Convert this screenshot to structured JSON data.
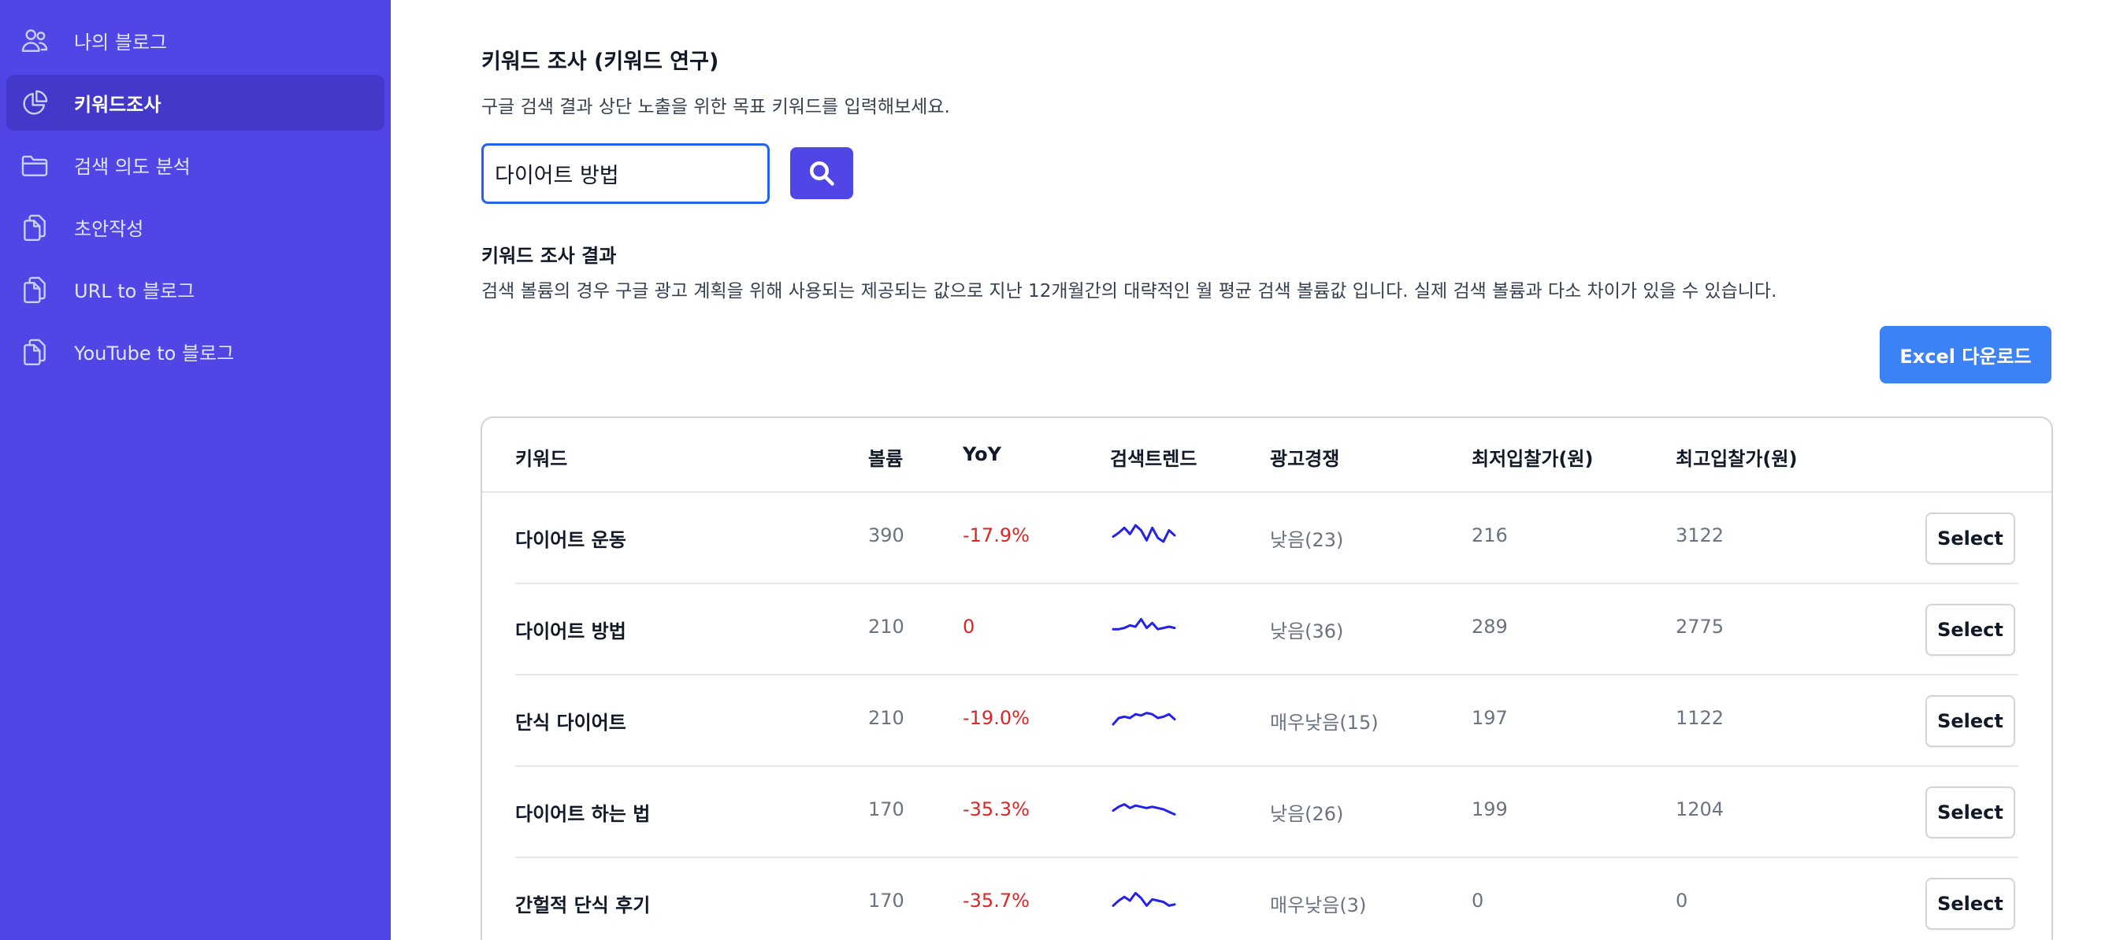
{
  "sidebar": {
    "items": [
      {
        "label": "나의 블로그",
        "icon": "users-icon"
      },
      {
        "label": "키워드조사",
        "icon": "pie-chart-icon"
      },
      {
        "label": "검색 의도 분석",
        "icon": "folder-icon"
      },
      {
        "label": "초안작성",
        "icon": "documents-icon"
      },
      {
        "label": "URL to 블로그",
        "icon": "documents-icon"
      },
      {
        "label": "YouTube to 블로그",
        "icon": "documents-icon"
      }
    ],
    "active_index": 1
  },
  "main": {
    "title": "키워드 조사 (키워드 연구)",
    "description": "구글 검색 결과 상단 노출을 위한 목표 키워드를 입력해보세요.",
    "search": {
      "value": "다이어트 방법",
      "placeholder": ""
    },
    "results_title": "키워드 조사 결과",
    "results_description": "검색 볼륨의 경우 구글 광고 계획을 위해 사용되는 제공되는 값으로 지난 12개월간의 대략적인 월 평균 검색 볼륨값 입니다. 실제 검색 볼륨과 다소 차이가 있을 수 있습니다.",
    "excel_button": "Excel 다운로드"
  },
  "table": {
    "headers": {
      "keyword": "키워드",
      "volume": "볼륨",
      "yoy": "YoY",
      "trend": "검색트렌드",
      "competition": "광고경쟁",
      "min_bid": "최저입찰가(원)",
      "max_bid": "최고입찰가(원)"
    },
    "rows": [
      {
        "keyword": "다이어트 운동",
        "volume": "390",
        "yoy": "-17.9%",
        "competition": "낮음(23)",
        "min_bid": "216",
        "max_bid": "3122",
        "select": "Select",
        "trend": [
          0.55,
          0.4,
          0.2,
          0.45,
          0.1,
          0.3,
          0.7,
          0.2,
          0.6,
          0.75,
          0.3,
          0.5
        ]
      },
      {
        "keyword": "다이어트 방법",
        "volume": "210",
        "yoy": "0",
        "competition": "낮음(36)",
        "min_bid": "289",
        "max_bid": "2775",
        "select": "Select",
        "trend": [
          0.6,
          0.6,
          0.55,
          0.45,
          0.5,
          0.2,
          0.55,
          0.35,
          0.6,
          0.55,
          0.5,
          0.55
        ]
      },
      {
        "keyword": "단식 다이어트",
        "volume": "210",
        "yoy": "-19.0%",
        "competition": "매우낮음(15)",
        "min_bid": "197",
        "max_bid": "1122",
        "select": "Select",
        "trend": [
          0.75,
          0.5,
          0.45,
          0.5,
          0.35,
          0.4,
          0.3,
          0.35,
          0.5,
          0.45,
          0.35,
          0.55
        ]
      },
      {
        "keyword": "다이어트 하는 법",
        "volume": "170",
        "yoy": "-35.3%",
        "competition": "낮음(26)",
        "min_bid": "199",
        "max_bid": "1204",
        "select": "Select",
        "trend": [
          0.55,
          0.4,
          0.3,
          0.45,
          0.35,
          0.4,
          0.45,
          0.4,
          0.45,
          0.5,
          0.6,
          0.7
        ]
      },
      {
        "keyword": "간헐적 단식 후기",
        "volume": "170",
        "yoy": "-35.7%",
        "competition": "매우낮음(3)",
        "min_bid": "0",
        "max_bid": "0",
        "select": "Select",
        "trend": [
          0.7,
          0.5,
          0.35,
          0.5,
          0.2,
          0.4,
          0.7,
          0.45,
          0.5,
          0.55,
          0.7,
          0.65
        ]
      }
    ]
  },
  "colors": {
    "sidebar_bg": "#4f46e5",
    "sidebar_active": "#4338ca",
    "primary": "#4f46e5",
    "excel_button": "#3b82f6",
    "negative": "#dc2626",
    "sparkline": "#2421e8"
  }
}
